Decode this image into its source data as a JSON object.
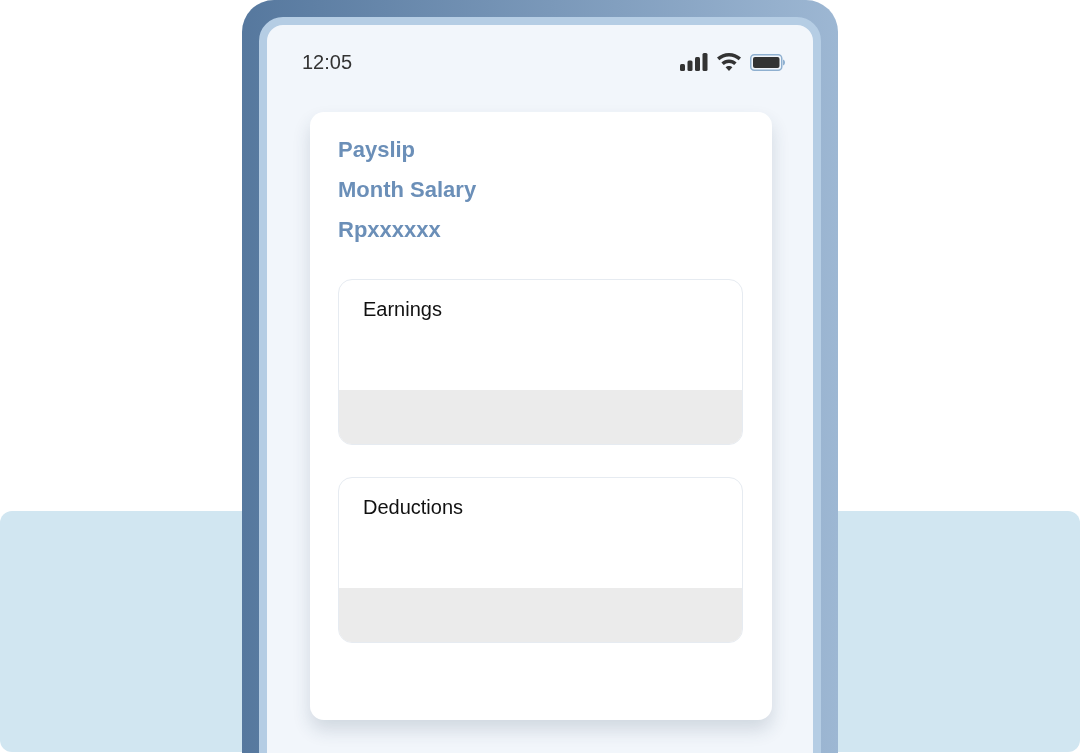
{
  "status_bar": {
    "time": "12:05"
  },
  "payslip": {
    "title": "Payslip",
    "subtitle": "Month Salary",
    "amount": "Rpxxxxxx",
    "sections": [
      {
        "title": "Earnings"
      },
      {
        "title": "Deductions"
      }
    ]
  }
}
